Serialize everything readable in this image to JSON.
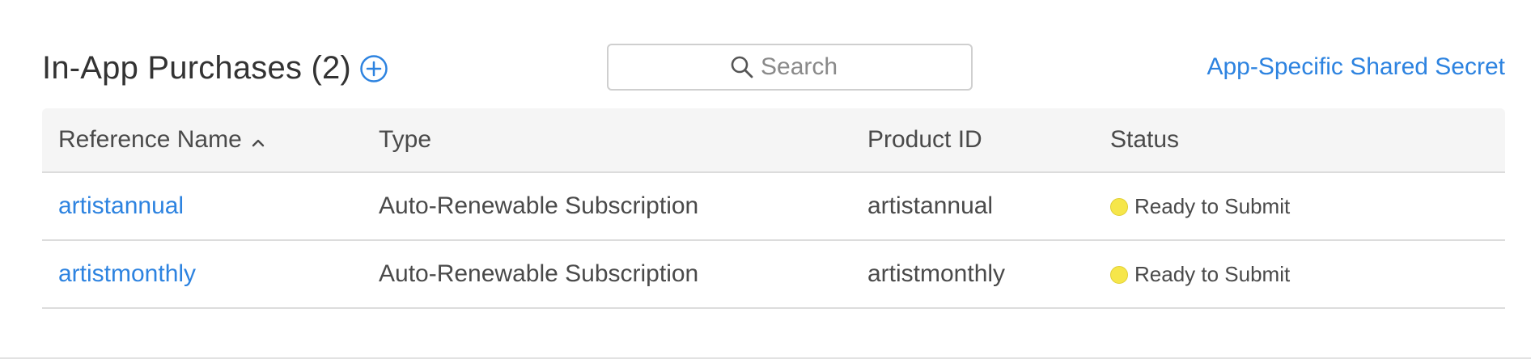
{
  "header": {
    "title": "In-App Purchases (2)",
    "add_icon": "plus-circle-icon",
    "secret_link": "App-Specific Shared Secret"
  },
  "search": {
    "placeholder": "Search",
    "value": "",
    "icon": "search-icon"
  },
  "table": {
    "columns": [
      "Reference Name",
      "Type",
      "Product ID",
      "Status"
    ],
    "sort_icon": "chevron-up-icon",
    "rows": [
      {
        "name": "artistannual",
        "type": "Auto-Renewable Subscription",
        "product_id": "artistannual",
        "status": "Ready to Submit"
      },
      {
        "name": "artistmonthly",
        "type": "Auto-Renewable Subscription",
        "product_id": "artistmonthly",
        "status": "Ready to Submit"
      }
    ]
  },
  "colors": {
    "accent": "#2d83e0",
    "status_ready": "#f6e64a",
    "header_bg": "#f5f5f5"
  }
}
